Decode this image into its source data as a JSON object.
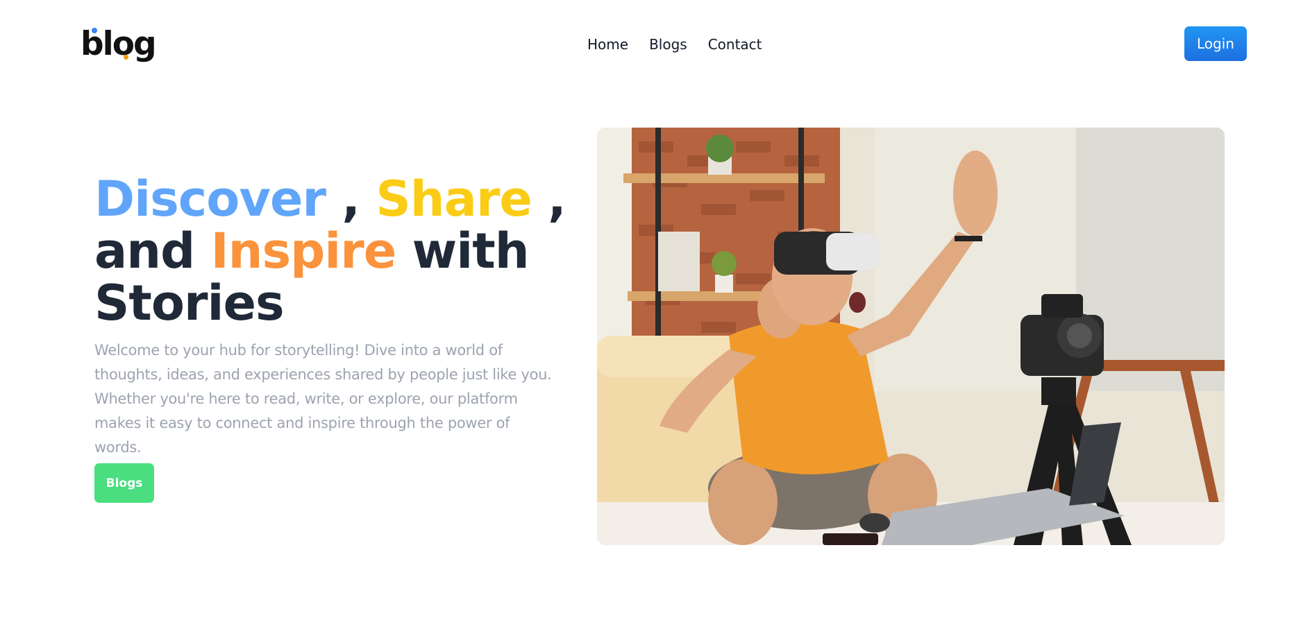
{
  "navbar": {
    "logo": "blog",
    "links": [
      "Home",
      "Blogs",
      "Contact"
    ],
    "login_label": "Login"
  },
  "hero": {
    "title": {
      "w1": "Discover",
      "sep1": " , ",
      "w2": "Share",
      "sep2": " ,",
      "w3": "and",
      "w4": "Inspire",
      "w5": "with",
      "w6": "Stories"
    },
    "description": "Welcome to your hub for storytelling! Dive into a world of thoughts, ideas, and experiences shared by people just like you. Whether you're here to read, write, or explore, our platform makes it easy to connect and inspire through the power of words.",
    "button_label": "Blogs",
    "image_subject": "man-with-vr-headset-recording-video"
  },
  "colors": {
    "discover": "#60a5fa",
    "share": "#facc15",
    "inspire": "#fb923c",
    "title_dark": "#1f2937",
    "login_button": "#1d6fe0",
    "blogs_button": "#4ade80"
  }
}
